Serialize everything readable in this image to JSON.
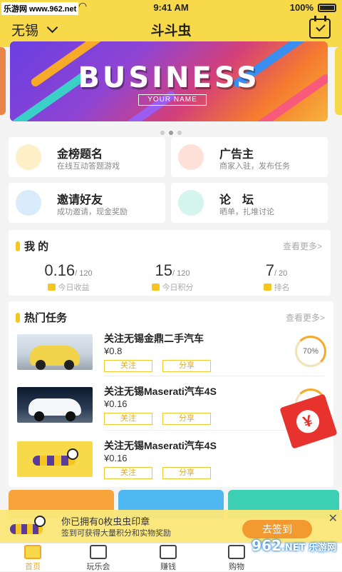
{
  "status": {
    "watermark": "乐游网 www.962.net",
    "time": "9:41 AM",
    "battery": "100%"
  },
  "header": {
    "city": "无锡",
    "title": "斗斗虫"
  },
  "banner": {
    "title": "BUSINESS",
    "subtitle": "YOUR NAME"
  },
  "features": [
    {
      "name": "金榜题名",
      "desc": "在线互动答题游戏",
      "color": "#f7c51f"
    },
    {
      "name": "广告主",
      "desc": "商家入驻，发布任务",
      "color": "#f47c5c"
    },
    {
      "name": "邀请好友",
      "desc": "成功邀请，现金奖励",
      "color": "#4aa8e8"
    },
    {
      "name": "论　坛",
      "desc": "晒单，扎堆讨论",
      "color": "#3cc6a8"
    }
  ],
  "mine": {
    "title": "我 的",
    "more": "查看更多>",
    "stats": [
      {
        "value": "0.16",
        "total": "/ 120",
        "label": "今日收益"
      },
      {
        "value": "15",
        "total": "/ 120",
        "label": "今日积分"
      },
      {
        "value": "7",
        "total": "/ 20",
        "label": "排名"
      }
    ]
  },
  "tasks": {
    "title": "热门任务",
    "more": "查看更多>",
    "items": [
      {
        "title": "关注无锡金鼎二手汽车",
        "price": "¥0.8",
        "follow": "关注",
        "share": "分享",
        "progress": "70%"
      },
      {
        "title": "关注无锡Maserati汽车4S",
        "price": "¥0.16",
        "follow": "关注",
        "share": "分享",
        "progress": "50%"
      },
      {
        "title": "关注无锡Maserati汽车4S",
        "price": "¥0.16",
        "follow": "关注",
        "share": "分享",
        "progress": ""
      }
    ]
  },
  "envelope": {
    "symbol": "¥"
  },
  "signin": {
    "line1": "你已拥有0枚虫虫印章",
    "line2": "签到可获得大量积分和实物奖励",
    "button": "去签到",
    "close": "✕"
  },
  "tabs": [
    {
      "label": "首页"
    },
    {
      "label": "玩乐会"
    },
    {
      "label": "赚钱"
    },
    {
      "label": "购物"
    }
  ],
  "sitemark": {
    "text": "962",
    "sub": ".NET 乐游网"
  }
}
